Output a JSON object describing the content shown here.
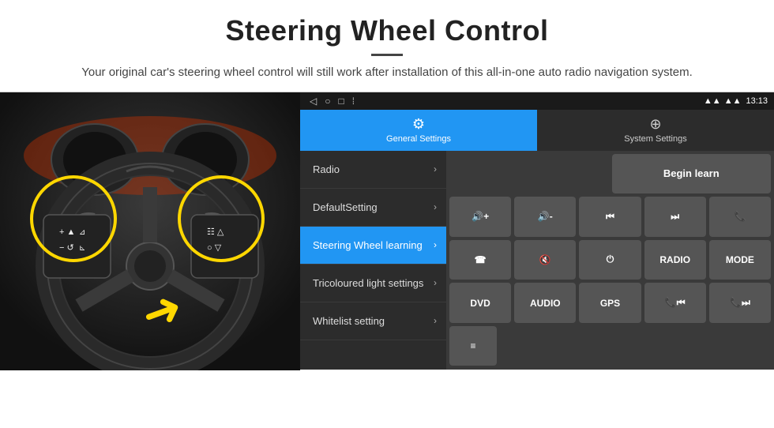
{
  "header": {
    "title": "Steering Wheel Control",
    "subtitle": "Your original car's steering wheel control will still work after installation of this all-in-one auto radio navigation system."
  },
  "status_bar": {
    "time": "13:13",
    "nav_back": "◁",
    "nav_home": "○",
    "nav_recent": "□",
    "nav_more": "⁞"
  },
  "tabs": {
    "active": {
      "label": "General Settings",
      "icon": "⚙"
    },
    "inactive": {
      "label": "System Settings",
      "icon": "🔧"
    }
  },
  "menu": {
    "items": [
      {
        "label": "Radio",
        "active": false
      },
      {
        "label": "DefaultSetting",
        "active": false
      },
      {
        "label": "Steering Wheel learning",
        "active": true
      },
      {
        "label": "Tricoloured light settings",
        "active": false
      },
      {
        "label": "Whitelist setting",
        "active": false
      }
    ]
  },
  "controls": {
    "begin_learn": "Begin learn",
    "row1": [
      "🔊+",
      "🔊-",
      "⏮",
      "⏭",
      "📞"
    ],
    "row2": [
      "☎",
      "🔊×",
      "⏻",
      "RADIO",
      "MODE"
    ],
    "row3": [
      "DVD",
      "AUDIO",
      "GPS",
      "📞⏮",
      "📞⏭"
    ],
    "row4_icon": "≡"
  }
}
